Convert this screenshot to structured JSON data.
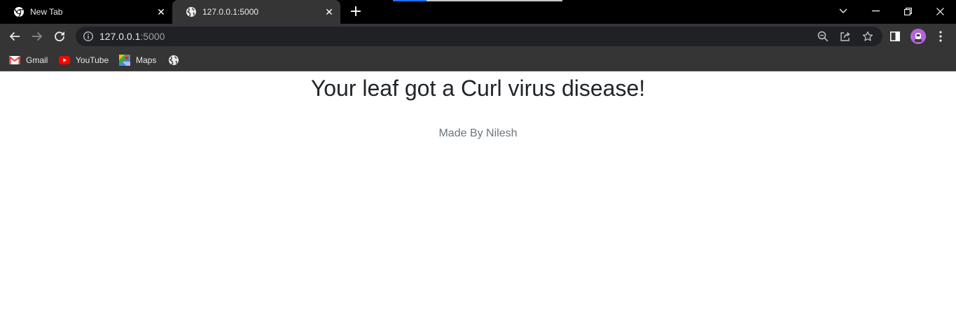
{
  "browser": {
    "tabs": [
      {
        "title": "New Tab",
        "icon": "chrome-icon",
        "active": false
      },
      {
        "title": "127.0.0.1:5000",
        "icon": "globe-icon",
        "active": true
      }
    ],
    "new_tab_label": "+",
    "address": {
      "host": "127.0.0.1",
      "port": ":5000"
    },
    "bookmarks": [
      {
        "label": "Gmail",
        "icon": "gmail-icon"
      },
      {
        "label": "YouTube",
        "icon": "youtube-icon"
      },
      {
        "label": "Maps",
        "icon": "maps-icon"
      },
      {
        "label": "",
        "icon": "globe-icon"
      }
    ],
    "colors": {
      "tabstrip": "#000000",
      "toolbar": "#353535",
      "omnibox": "#202124",
      "avatar": "#b166d8"
    }
  },
  "page": {
    "heading": "Your leaf got a Curl virus disease!",
    "credit": "Made By Nilesh"
  }
}
